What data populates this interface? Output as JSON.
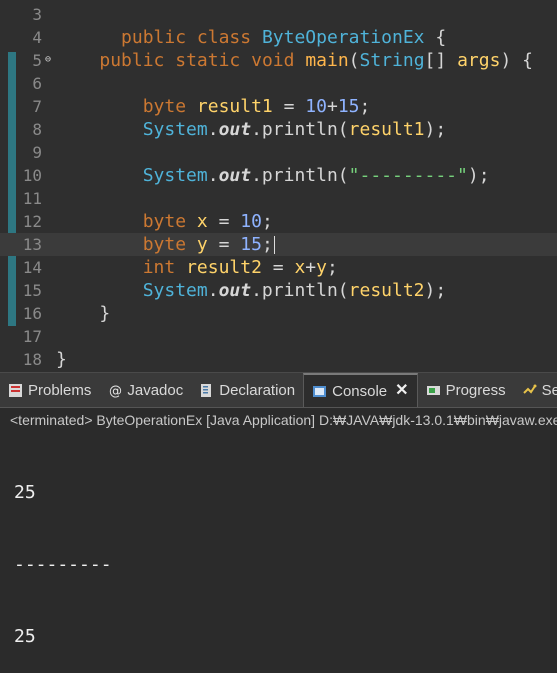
{
  "editor": {
    "lines": [
      {
        "number": "3",
        "tokens": [
          "public",
          "class",
          "ByteOperationEx",
          "{"
        ]
      },
      {
        "number": "4",
        "tokens": []
      },
      {
        "number": "5",
        "fold": "⊖",
        "tokens": [
          "public",
          "static",
          "void",
          "main",
          "String",
          "[]",
          "args",
          ") {"
        ]
      },
      {
        "number": "6",
        "tokens": []
      },
      {
        "number": "7",
        "tokens": [
          "byte",
          "result1",
          "=",
          "10",
          "+",
          "15",
          ";"
        ]
      },
      {
        "number": "8",
        "tokens": [
          "System",
          ".",
          "out",
          ".println(",
          "result1",
          ");"
        ]
      },
      {
        "number": "9",
        "tokens": []
      },
      {
        "number": "10",
        "tokens": [
          "System",
          ".",
          "out",
          ".println(",
          "\"---------\"",
          ");"
        ]
      },
      {
        "number": "11",
        "tokens": []
      },
      {
        "number": "12",
        "tokens": [
          "byte",
          "x",
          "=",
          "10",
          ";"
        ]
      },
      {
        "number": "13",
        "tokens": [
          "byte",
          "y",
          "=",
          "15",
          ";"
        ]
      },
      {
        "number": "14",
        "tokens": [
          "int",
          "result2",
          "=",
          "x",
          "+",
          "y",
          ";"
        ]
      },
      {
        "number": "15",
        "tokens": [
          "System",
          ".",
          "out",
          ".println(",
          "result2",
          ");"
        ]
      },
      {
        "number": "16",
        "tokens": [
          "}"
        ]
      },
      {
        "number": "17",
        "tokens": []
      },
      {
        "number": "18",
        "tokens": [
          "}"
        ]
      }
    ]
  },
  "tabs": {
    "problems": "Problems",
    "javadoc": "Javadoc",
    "declaration": "Declaration",
    "console": "Console",
    "progress": "Progress",
    "servers": "Servers"
  },
  "console": {
    "header": "<terminated> ByteOperationEx [Java Application] D:₩JAVA₩jdk-13.0.1₩bin₩javaw.exe",
    "output": [
      "25",
      "---------",
      "25"
    ]
  },
  "colors": {
    "editor_bg": "#2f2f2f",
    "keyword": "#cc7832",
    "class_name": "#4fb3d9",
    "method_name": "#ffb64c",
    "identifier": "#ffd36a",
    "number": "#8fb3ff",
    "string": "#76d17c",
    "gutter_strip": "#2f7f8c",
    "tab_bar": "#3a3a3a",
    "console_bg": "#2b2b2b"
  },
  "icons": {
    "problems": "problems-icon",
    "javadoc": "javadoc-icon",
    "declaration": "declaration-icon",
    "console": "console-icon",
    "progress": "progress-icon",
    "servers": "servers-icon"
  }
}
